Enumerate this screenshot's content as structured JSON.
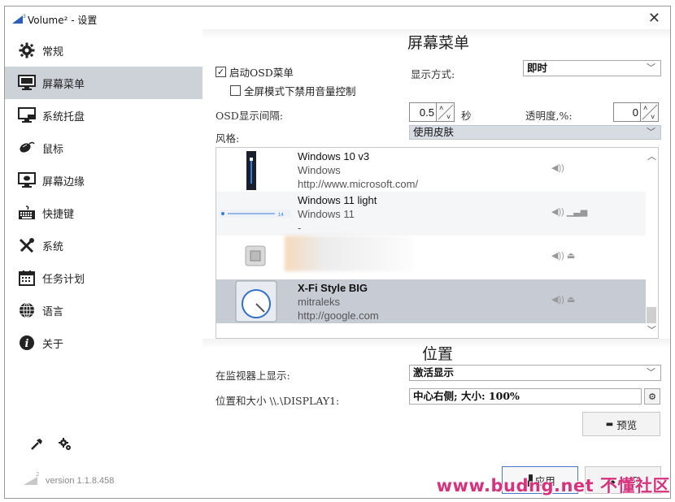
{
  "window": {
    "title": "Volume² - 设置",
    "close_glyph": "✕",
    "version": "version 1.1.8.458",
    "watermark": "www.budng.net 不懂社区"
  },
  "sidebar": {
    "items": [
      {
        "label": "常规",
        "icon": "gear-icon"
      },
      {
        "label": "屏幕菜单",
        "icon": "monitor-icon"
      },
      {
        "label": "系统托盘",
        "icon": "tray-icon"
      },
      {
        "label": "鼠标",
        "icon": "mouse-icon"
      },
      {
        "label": "屏幕边缘",
        "icon": "screen-edge-icon"
      },
      {
        "label": "快捷键",
        "icon": "keyboard-icon"
      },
      {
        "label": "系统",
        "icon": "tools-icon"
      },
      {
        "label": "任务计划",
        "icon": "calendar-icon"
      },
      {
        "label": "语言",
        "icon": "globe-icon"
      },
      {
        "label": "关于",
        "icon": "info-icon"
      }
    ],
    "active_index": 1
  },
  "osd": {
    "section_title": "屏幕菜单",
    "enable_label": "启动OSD菜单",
    "enable_checked": true,
    "fullscreen_label": "全屏模式下禁用音量控制",
    "fullscreen_checked": false,
    "display_mode_label": "显示方式:",
    "display_mode_value": "即时",
    "interval_label": "OSD显示间隔:",
    "interval_value": "0.5",
    "interval_unit": "秒",
    "opacity_label": "透明度,%:",
    "opacity_value": "0",
    "style_label": "风格:",
    "style_value": "使用皮肤"
  },
  "skins": [
    {
      "name": "Windows 10 v3",
      "author": "Windows",
      "url": "http://www.microsoft.com/"
    },
    {
      "name": "Windows 11 light",
      "author": "Windows 11",
      "url": "-"
    },
    {
      "name": "",
      "author": "",
      "url": ""
    },
    {
      "name": "X-Fi Style BIG",
      "author": "mitraleks",
      "url": "http://google.com"
    }
  ],
  "position": {
    "section_title": "位置",
    "monitor_label": "在监视器上显示:",
    "monitor_value": "激活显示",
    "size_label": "位置和大小 \\\\.\\DISPLAY1:",
    "size_value": "中心右侧; 大小: 100%",
    "preview_label": "预览"
  },
  "footer": {
    "apply_label": "应用",
    "close_label": "关闭"
  }
}
